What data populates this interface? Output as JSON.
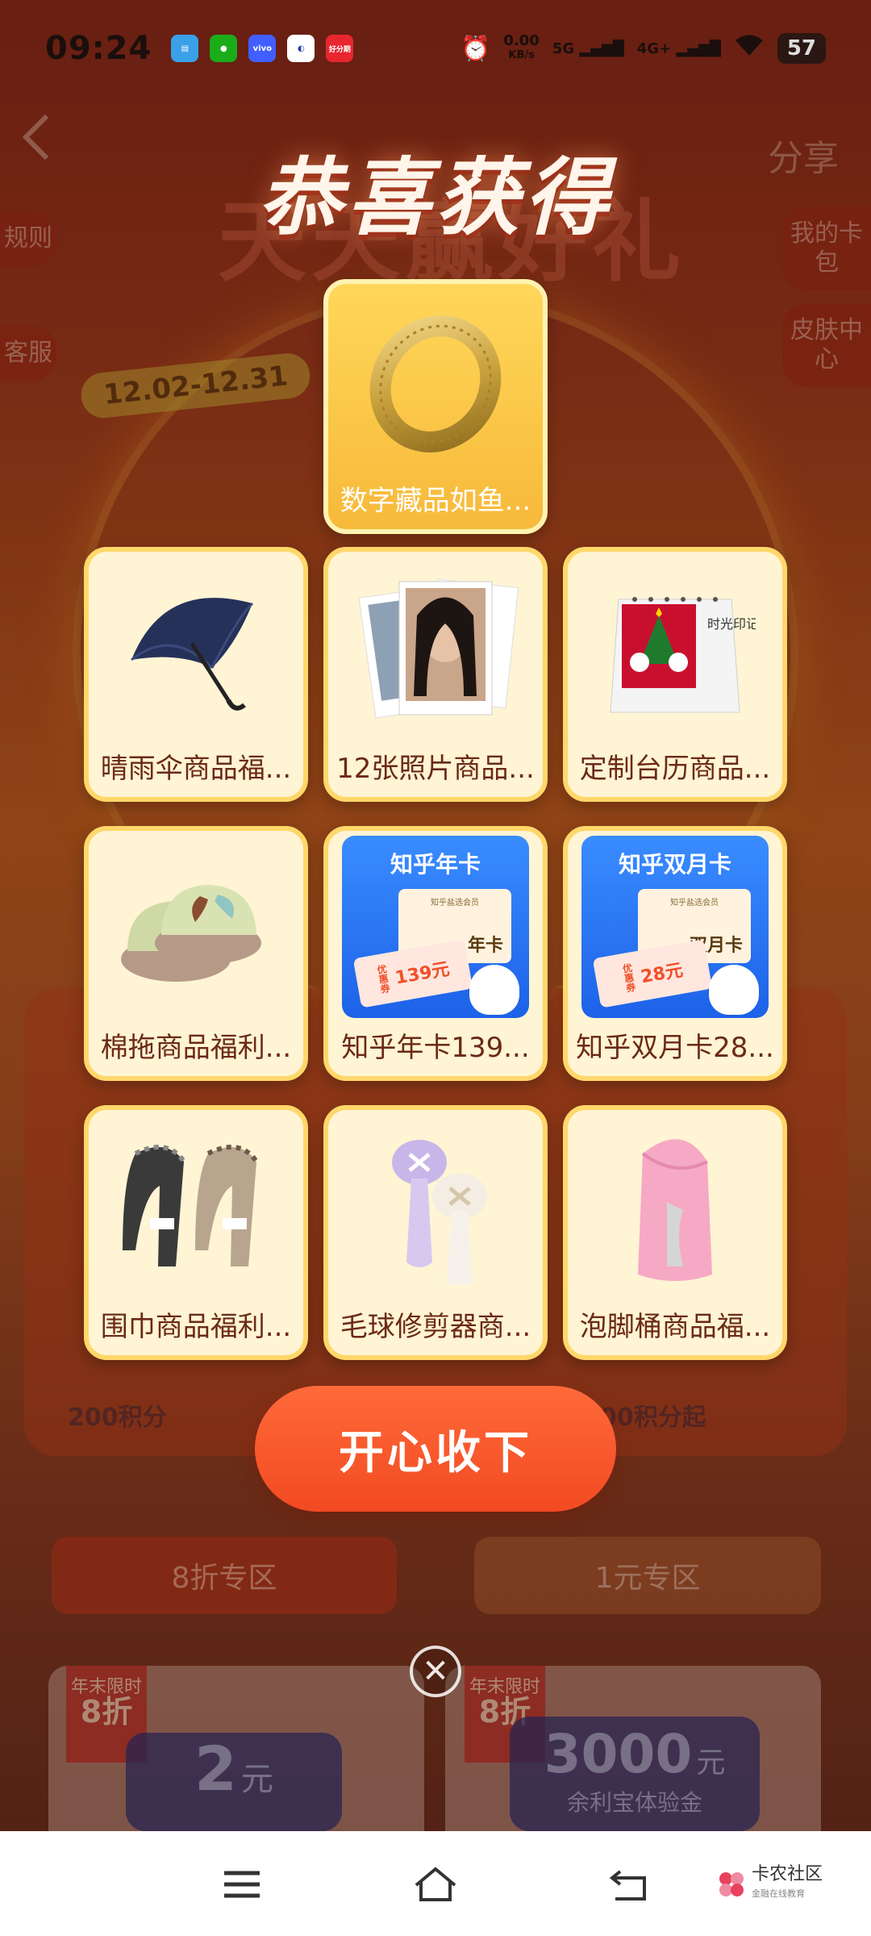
{
  "status_bar": {
    "time": "09:24",
    "network_speed": "0.00",
    "network_speed_unit": "KB/s",
    "signal_1": "5G",
    "signal_2": "4G+",
    "battery": "57",
    "apps": [
      {
        "icon": "wallet-app-icon",
        "color": "#3aa0e8",
        "label": ""
      },
      {
        "icon": "wechat-app-icon",
        "color": "#1aad19",
        "label": ""
      },
      {
        "icon": "vivo-app-icon",
        "color": "#415fff",
        "label": "vivo"
      },
      {
        "icon": "app-icon",
        "color": "#ffffff",
        "label": ""
      },
      {
        "icon": "fenqile-app-icon",
        "color": "#e8262e",
        "label": "好分期"
      }
    ]
  },
  "background": {
    "share": "分享",
    "side_left": [
      "规则",
      "客服"
    ],
    "side_right": [
      "我的卡包",
      "皮肤中心"
    ],
    "banner_title": "天天赢好礼",
    "date_range": "12.02-12.31",
    "points_left": "200积分",
    "points_right": "00积分起",
    "tab_left": "8折专区",
    "tab_right": "1元专区",
    "tag_top": "年末限时",
    "tag_bottom": "8折",
    "coupon_left_value": "2",
    "coupon_left_unit": "元",
    "coupon_right_value": "3000",
    "coupon_right_unit": "元",
    "coupon_right_desc": "余利宝体验金"
  },
  "modal": {
    "title": "恭喜获得",
    "featured_prize": {
      "name": "数字藏品如鱼...",
      "icon": "gold-bracelet-icon"
    },
    "prizes": [
      {
        "name": "晴雨伞商品福...",
        "icon": "umbrella-icon"
      },
      {
        "name": "12张照片商品...",
        "icon": "photo-prints-icon"
      },
      {
        "name": "定制台历商品...",
        "icon": "desk-calendar-icon"
      },
      {
        "name": "棉拖商品福利...",
        "icon": "slippers-icon"
      },
      {
        "name": "知乎年卡139...",
        "icon": "zhihu-card-icon"
      },
      {
        "name": "知乎双月卡28...",
        "icon": "zhihu-card-icon"
      },
      {
        "name": "围巾商品福利...",
        "icon": "scarf-icon"
      },
      {
        "name": "毛球修剪器商...",
        "icon": "lint-remover-icon"
      },
      {
        "name": "泡脚桶商品福...",
        "icon": "foot-bath-icon"
      }
    ],
    "calendar_text": "时光印记",
    "zhihu_year": {
      "title": "知乎年卡",
      "member": "知乎盐选会员",
      "type": "年卡",
      "coupon_tag": "优惠券",
      "coupon": "139元"
    },
    "zhihu_2m": {
      "title": "知乎双月卡",
      "member": "知乎盐选会员",
      "type": "双月卡",
      "coupon_tag": "优惠券",
      "coupon": "28元"
    },
    "accept_label": "开心收下",
    "close_icon": "close-icon"
  },
  "watermark": {
    "name": "卡农社区",
    "sub": "金融在线教育"
  },
  "colors": {
    "accent": "#f24a22",
    "card_bg": "#fff4d4",
    "card_border": "#ffd76a",
    "featured": "#f7b93a"
  }
}
